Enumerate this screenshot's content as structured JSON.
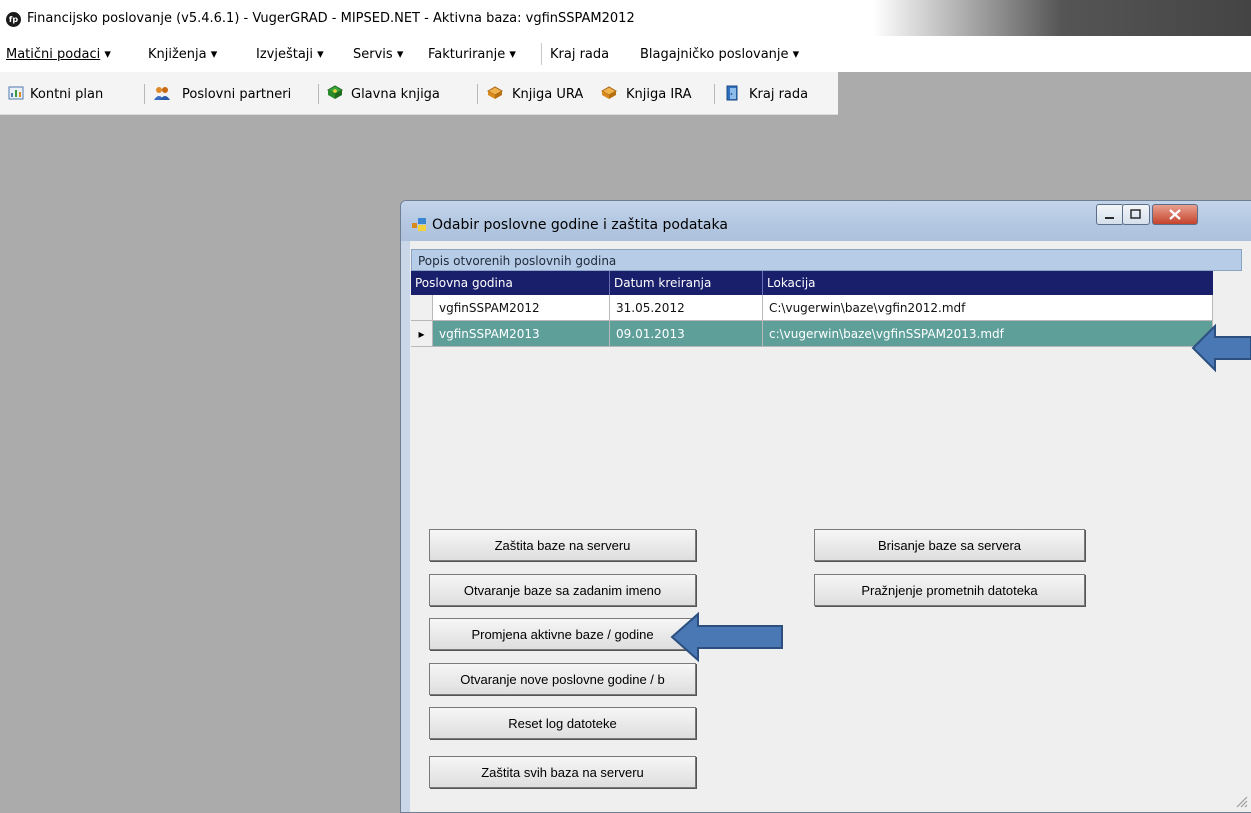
{
  "app": {
    "title": "Financijsko poslovanje (v5.4.6.1) - VugerGRAD - MIPSED.NET - Aktivna baza: vgfinSSPAM2012",
    "icon_text": "fp"
  },
  "menu": {
    "items": [
      "Matični podaci",
      "Knjiženja",
      "Izvještaji",
      "Servis",
      "Fakturiranje",
      "Kraj rada",
      "Blagajničko poslovanje"
    ],
    "arrow": "▾"
  },
  "toolbar": {
    "items": [
      "Kontni plan",
      "Poslovni partneri",
      "Glavna knjiga",
      "Knjiga URA",
      "Knjiga IRA",
      "Kraj rada"
    ]
  },
  "dialog": {
    "title": "Odabir poslovne godine i zaštita podataka",
    "grid_caption": "Popis otvorenih poslovnih godina",
    "columns": [
      "Poslovna godina",
      "Datum kreiranja",
      "Lokacija"
    ],
    "rows": [
      {
        "godina": "vgfinSSPAM2012",
        "datum": "31.05.2012",
        "lokacija": "C:\\vugerwin\\baze\\vgfin2012.mdf",
        "selected": false
      },
      {
        "godina": "vgfinSSPAM2013",
        "datum": "09.01.2013",
        "lokacija": "c:\\vugerwin\\baze\\vgfinSSPAM2013.mdf",
        "selected": true
      }
    ],
    "current_row_marker": "▸",
    "buttons": {
      "zastita_baze": "Zaštita baze na serveru",
      "brisanje_baze": "Brisanje baze sa servera",
      "otvaranje_baze": "Otvaranje baze sa zadanim imeno",
      "praznjenje": "Pražnjenje prometnih datoteka",
      "promjena_aktivne": "Promjena aktivne baze / godine",
      "otvaranje_nove": "Otvaranje nove poslovne godine / b",
      "reset_log": "Reset log datoteke",
      "zastita_svih": "Zaštita svih baza na serveru"
    }
  },
  "colors": {
    "grid_header": "#1a1f6b",
    "selected_row": "#5f9f9a",
    "arrow_fill": "#4a78b4",
    "workspace": "#ababab"
  }
}
